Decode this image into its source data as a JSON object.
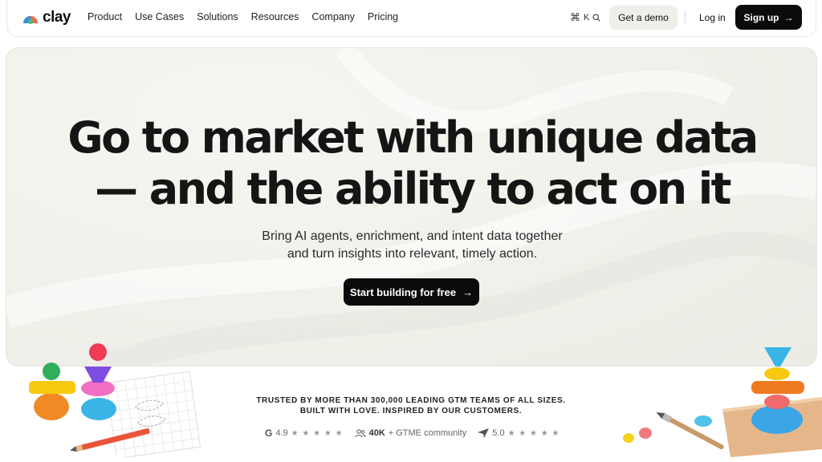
{
  "nav": {
    "logo_text": "clay",
    "menu": [
      "Product",
      "Use Cases",
      "Solutions",
      "Resources",
      "Company",
      "Pricing"
    ],
    "shortcut_key": "K",
    "demo_label": "Get a demo",
    "login_label": "Log in",
    "signup_label": "Sign up"
  },
  "hero": {
    "headline_line1": "Go to market with unique data",
    "headline_line2": "— and the ability to act on it",
    "sub_line1": "Bring AI agents, enrichment, and intent data together",
    "sub_line2": "and turn insights into relevant, timely action.",
    "cta_label": "Start building for free"
  },
  "trust": {
    "line1": "TRUSTED BY MORE THAN 300,000 LEADING GTM TEAMS OF ALL SIZES.",
    "line2": "BUILT WITH LOVE. INSPIRED BY OUR CUSTOMERS."
  },
  "ratings": {
    "g2_score": "4.9",
    "community_count": "40K",
    "community_label": "+ GTME community",
    "capterra_score": "5.0",
    "stars": "★ ★ ★ ★ ★"
  },
  "icons": {
    "command": "command-icon",
    "search": "search-icon",
    "arrow": "arrow-right-icon",
    "g2": "g2-icon",
    "people": "people-icon",
    "capterra": "capterra-icon"
  },
  "colors": {
    "primary_button": "#0b0b0b",
    "demo_button": "#efeee9",
    "hero_bg": "#f1f0ea"
  }
}
